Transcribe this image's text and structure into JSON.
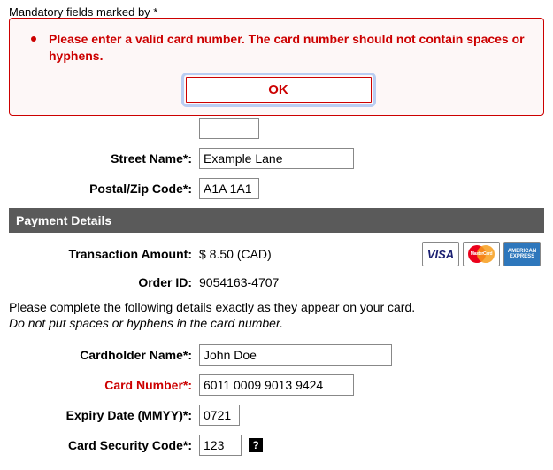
{
  "mandatory_note": "Mandatory fields marked by *",
  "error_dialog": {
    "message": "Please enter a valid card number. The card number should not contain spaces or hyphens.",
    "ok_label": "OK"
  },
  "address": {
    "street_no_label": "",
    "street_no_value": "",
    "street_name_label": "Street Name*:",
    "street_name_value": "Example Lane",
    "postal_label": "Postal/Zip Code*:",
    "postal_value": "A1A 1A1"
  },
  "payment": {
    "header": "Payment Details",
    "amount_label": "Transaction Amount:",
    "amount_value": "$ 8.50 (CAD)",
    "order_label": "Order ID:",
    "order_value": "9054163-4707",
    "instruction_line1": "Please complete the following details exactly as they appear on your card.",
    "instruction_line2": "Do not put spaces or hyphens in the card number.",
    "cardholder_label": "Cardholder Name*:",
    "cardholder_value": "John Doe",
    "cardnumber_label": "Card Number*:",
    "cardnumber_value": "6011 0009 9013 9424",
    "expiry_label": "Expiry Date (MMYY)*:",
    "expiry_value": "0721",
    "csc_label": "Card Security Code*:",
    "csc_value": "123",
    "logos": {
      "visa": "VISA",
      "mastercard": "MasterCard",
      "amex": "AMERICAN EXPRESS"
    },
    "help_glyph": "?"
  }
}
